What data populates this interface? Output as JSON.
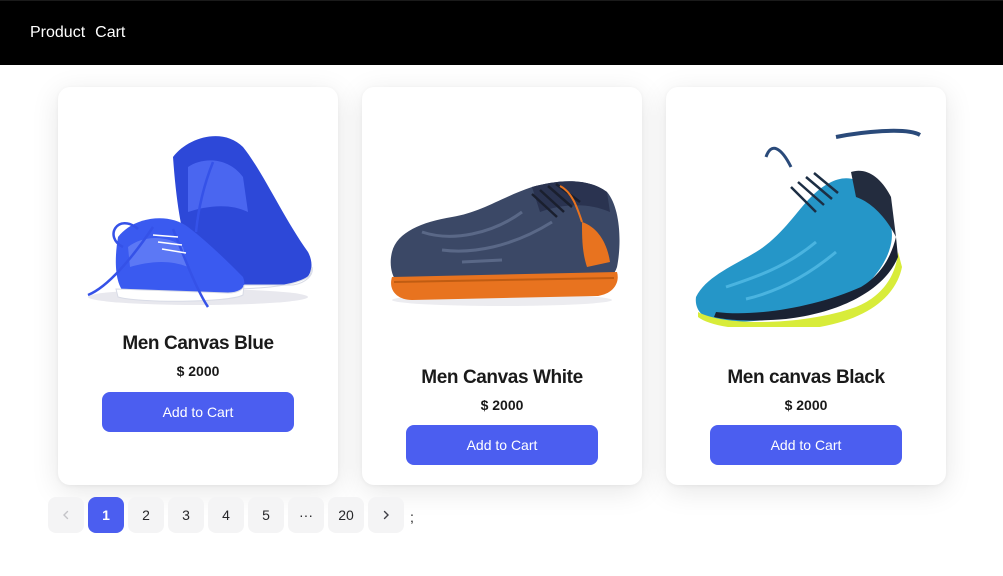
{
  "nav": {
    "links": [
      "Product",
      "Cart"
    ]
  },
  "products": [
    {
      "title": "Men Canvas Blue",
      "price": "$ 2000",
      "button": "Add to Cart",
      "image": "blue-running-shoes-image"
    },
    {
      "title": "Men Canvas White",
      "price": "$ 2000",
      "button": "Add to Cart",
      "image": "navy-orange-trail-shoe-image"
    },
    {
      "title": "Men canvas Black",
      "price": "$ 2000",
      "button": "Add to Cart",
      "image": "teal-running-shoe-image"
    }
  ],
  "pagination": {
    "prev_icon": "chevron-left-icon",
    "pages": [
      "1",
      "2",
      "3",
      "4",
      "5"
    ],
    "ellipsis": "···",
    "last": "20",
    "next_icon": "chevron-right-icon",
    "active_page": "1",
    "trailing": ";"
  },
  "colors": {
    "navbar": "#000000",
    "accent": "#4b5ef0",
    "page_bg": "#ffffff"
  }
}
